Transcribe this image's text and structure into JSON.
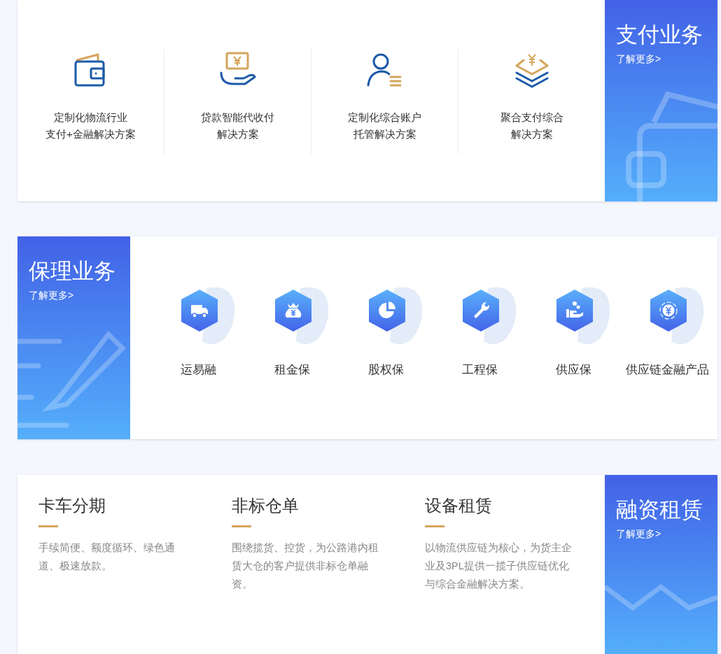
{
  "payment": {
    "title": "支付业务",
    "more": "了解更多>",
    "items": [
      {
        "lines": [
          "定制化物流行业",
          "支付+金融解决方案"
        ]
      },
      {
        "lines": [
          "贷款智能代收付",
          "解决方案"
        ]
      },
      {
        "lines": [
          "定制化综合账户",
          "托管解决方案"
        ]
      },
      {
        "lines": [
          "聚合支付综合",
          "解决方案"
        ]
      }
    ]
  },
  "factoring": {
    "title": "保理业务",
    "more": "了解更多>",
    "items": [
      {
        "label": "运易融"
      },
      {
        "label": "租金保"
      },
      {
        "label": "股权保"
      },
      {
        "label": "工程保"
      },
      {
        "label": "供应保"
      },
      {
        "label": "供应链金融产品"
      }
    ]
  },
  "leasing": {
    "title": "融资租赁",
    "more": "了解更多>",
    "items": [
      {
        "title": "卡车分期",
        "description": "手续简便、额度循环、绿色通道、极速放款。"
      },
      {
        "title": "非标仓单",
        "description": "围绕揽货、控货，为公路港内租赁大仓的客户提供非标仓单融资。"
      },
      {
        "title": "设备租赁",
        "description": "以物流供应链为核心，为货主企业及3PL提供一揽子供应链优化与综合金融解决方案。"
      }
    ]
  }
}
